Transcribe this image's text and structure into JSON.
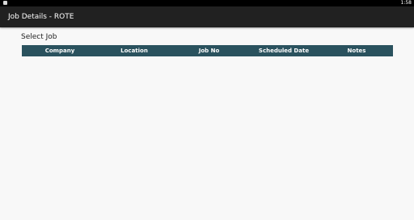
{
  "status_bar": {
    "time": "1:58",
    "notification_icon": "square-notification-icon"
  },
  "app_bar": {
    "title": "Job Details - ROTE"
  },
  "main": {
    "section_title": "Select Job",
    "table": {
      "columns": [
        "Company",
        "Location",
        "Job No",
        "Scheduled Date",
        "Notes"
      ],
      "rows": []
    }
  },
  "colors": {
    "status_bar": "#000000",
    "app_bar": "#212121",
    "table_header": "#2a525e",
    "background": "#f8f8f8"
  }
}
